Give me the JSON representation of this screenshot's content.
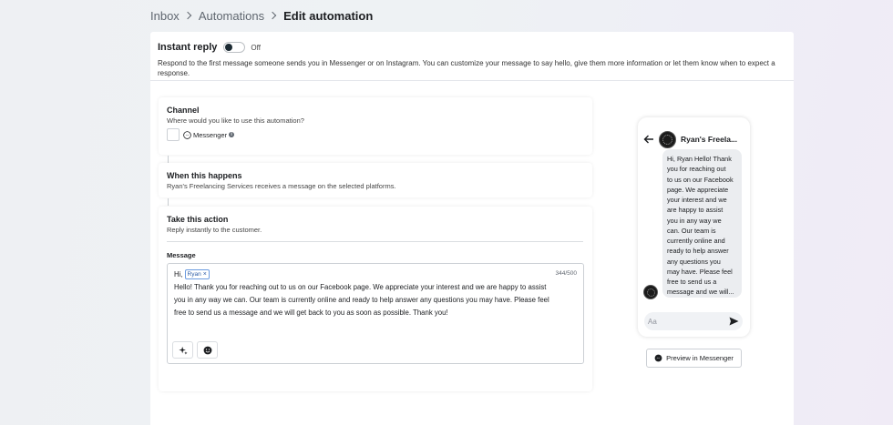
{
  "breadcrumb": {
    "inbox": "Inbox",
    "automations": "Automations",
    "current": "Edit automation"
  },
  "header": {
    "title": "Instant reply",
    "toggle_state": "Off",
    "description": "Respond to the first message someone sends you in Messenger or on Instagram. You can customize your message to say hello, give them more information or let them know when to expect a response."
  },
  "channel": {
    "title": "Channel",
    "subtitle": "Where would you like to use this automation?",
    "platform": "Messenger",
    "info_icon": "i"
  },
  "trigger": {
    "title": "When this happens",
    "subtitle": "Ryan's Freelancing Services receives a message on the selected platforms."
  },
  "action": {
    "title": "Take this action",
    "subtitle": "Reply instantly to the customer.",
    "message_label": "Message",
    "greeting": "Hi,",
    "name_chip": "Ryan",
    "chip_remove": "×",
    "counter": "344/500",
    "lines": [
      "Hello! Thank you for reaching out to us on our Facebook page. We appreciate your interest and we are happy to assist",
      "you in any way we can. Our team is currently online and ready to help answer any questions you may have. Please feel",
      "free to send us a message and we will get back to you as soon as possible. Thank you!"
    ]
  },
  "preview": {
    "page_name": "Ryan's Freela...",
    "bubble_lines": [
      "Hi, Ryan Hello! Thank",
      "you for reaching out",
      "to us on our Facebook",
      "page. We appreciate",
      "your interest and we",
      "are happy to assist",
      "you in any way we",
      "can. Our team is",
      "currently online and",
      "ready to help answer",
      "any questions you",
      "may have. Please feel",
      "free to send us a",
      "message and we will..."
    ],
    "compose_placeholder": "Aa",
    "button_label": "Preview in Messenger"
  },
  "icons": {
    "messenger": "messenger-icon",
    "send": "send-icon",
    "back": "back-arrow-icon",
    "sparkle": "sparkle-icon",
    "emoji": "emoji-icon"
  }
}
